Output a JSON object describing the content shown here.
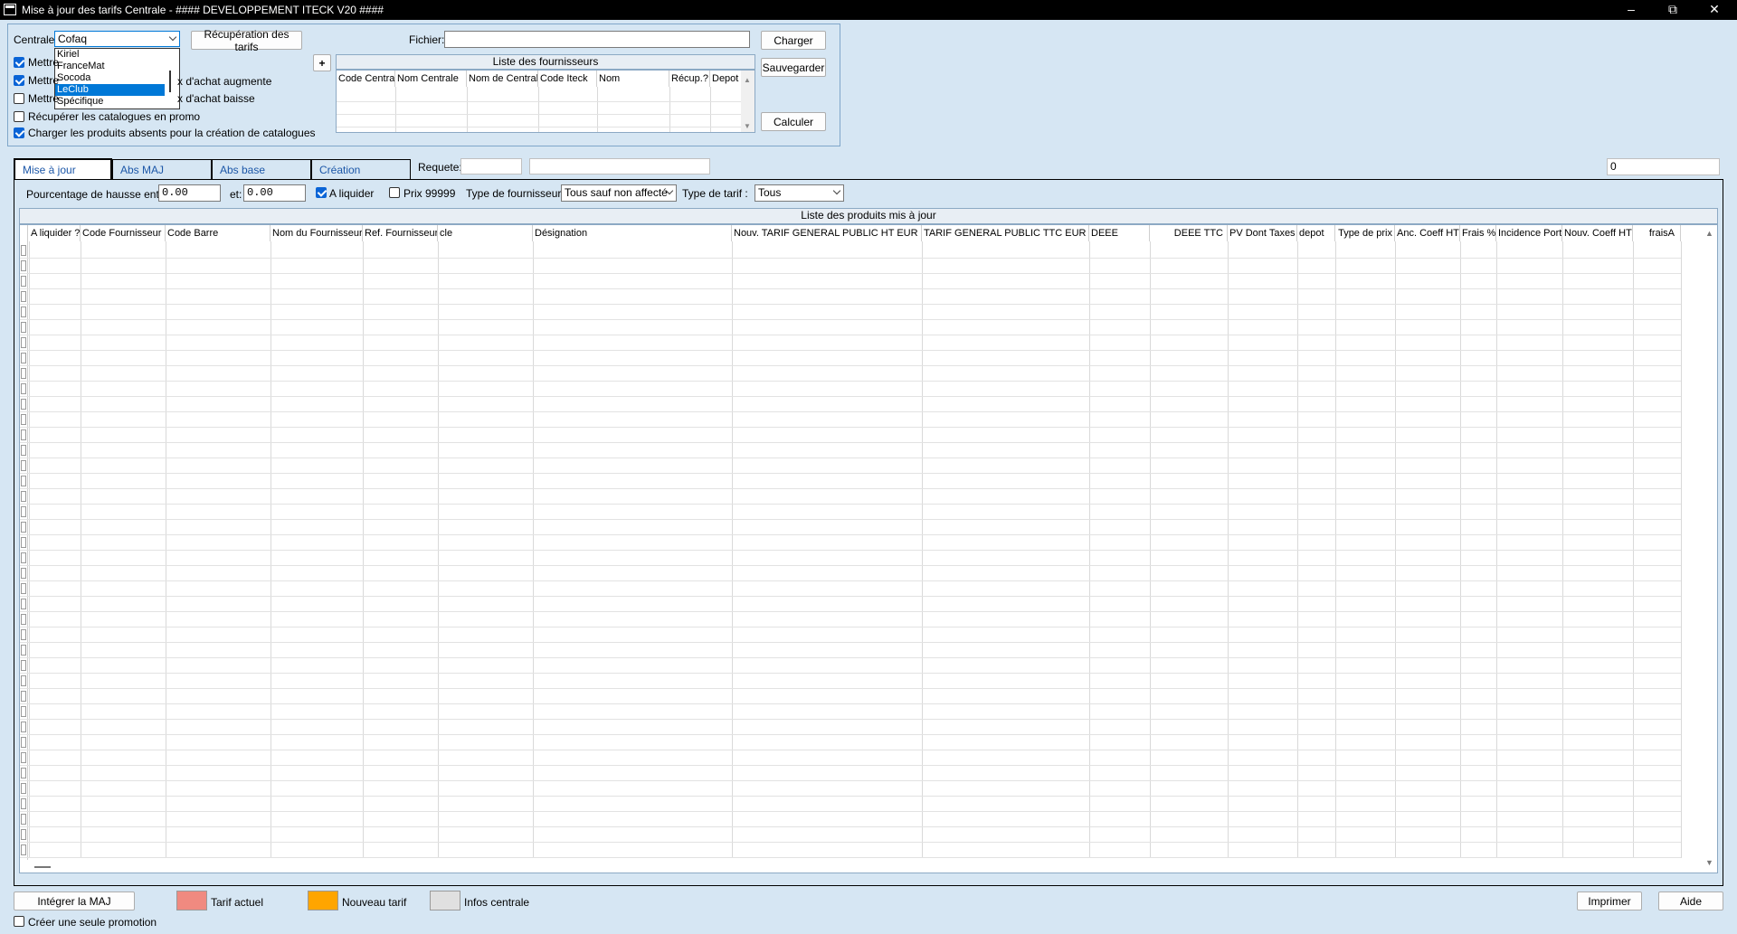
{
  "window": {
    "title": "Mise à jour des tarifs Centrale - #### DEVELOPPEMENT ITECK V20 ####"
  },
  "top": {
    "centrale_label": "Centrale:",
    "centrale_value": "Cofaq",
    "centrale_options": [
      "Kiriel",
      "FranceMat",
      "Socoda",
      "LeClub",
      "Spécifique"
    ],
    "centrale_selected": "LeClub",
    "recuperation_button": "Récupération des tarifs",
    "fichier_label": "Fichier:",
    "fichier_value": "",
    "charger_button": "Charger",
    "sauvegarder_button": "Sauvegarder",
    "calculer_button": "Calculer",
    "plus_button": "+",
    "checkboxes": [
      {
        "label": "Mettre",
        "checked": true
      },
      {
        "label": "Mettre",
        "checked": true
      },
      {
        "label": "Mettre",
        "checked": false
      },
      {
        "label": "Récupérer les catalogues en promo",
        "checked": false
      },
      {
        "label": "Charger les produits absents pour la création de catalogues",
        "checked": true
      }
    ],
    "checkbox_tail_1": "x d'achat augmente",
    "checkbox_tail_2": "x d'achat baisse"
  },
  "fournisseurs": {
    "title": "Liste des fournisseurs",
    "columns": [
      "Code Centra",
      "Nom Centrale",
      "Nom de Centrale",
      "Code Iteck",
      "Nom",
      "Récup.?",
      "Depot"
    ]
  },
  "tabs": {
    "items": [
      "Mise à jour",
      "Abs MAJ",
      "Abs base",
      "Création"
    ],
    "active": "Mise à jour",
    "requete_label": "Requete:",
    "requete_value": "",
    "count_value": "0"
  },
  "filters": {
    "pourcentage_label": "Pourcentage de hausse entre:",
    "from_value": "0.00",
    "et_label": "et:",
    "to_value": "0.00",
    "a_liquider_label": "A liquider",
    "a_liquider_checked": true,
    "prix_label": "Prix 99999",
    "prix_checked": false,
    "type_fournisseur_label": "Type de fournisseur :",
    "type_fournisseur_value": "Tous sauf non affecté",
    "type_tarif_label": "Type de tarif :",
    "type_tarif_value": "Tous"
  },
  "produits": {
    "title": "Liste des produits mis à jour",
    "columns": [
      "A liquider ?",
      "Code Fournisseur",
      "Code Barre",
      "Nom du Fournisseur",
      "Ref. Fournisseur",
      "cle",
      "Désignation",
      "Nouv. TARIF GENERAL PUBLIC HT EUR",
      "TARIF GENERAL PUBLIC TTC EUR",
      "DEEE",
      "DEEE TTC",
      "PV Dont Taxes",
      "depot",
      "Type de prix",
      "Anc. Coeff HT",
      "Frais %",
      "Incidence Port",
      "Nouv. Coeff HT",
      "fraisA"
    ]
  },
  "bottom": {
    "integrer_button": "Intégrer la MAJ",
    "legend_tarif_actuel": "Tarif actuel",
    "legend_nouveau_tarif": "Nouveau tarif",
    "legend_infos_centrale": "Infos centrale",
    "color_tarif_actuel": "#f08a80",
    "color_nouveau_tarif": "#ffa500",
    "color_infos_centrale": "#e0e0e0",
    "imprimer_button": "Imprimer",
    "aide_button": "Aide",
    "creer_promo_label": "Créer une seule promotion",
    "creer_promo_checked": false
  }
}
